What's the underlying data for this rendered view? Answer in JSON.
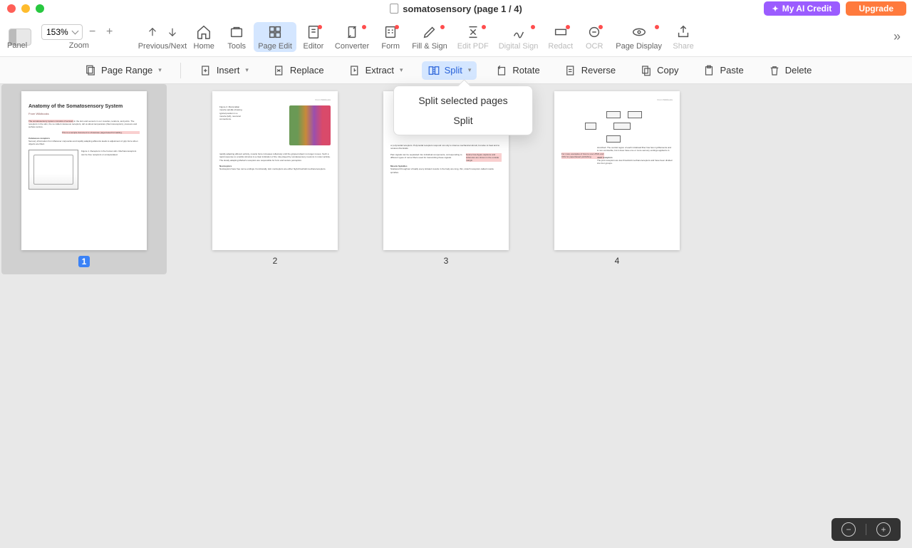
{
  "title": "somatosensory (page 1 / 4)",
  "header": {
    "ai_button": "My AI Credit",
    "upgrade_button": "Upgrade"
  },
  "toolbar": {
    "panel": "Panel",
    "zoom_label": "Zoom",
    "zoom_value": "153%",
    "prev_next": "Previous/Next",
    "home": "Home",
    "tools": "Tools",
    "page_edit": "Page Edit",
    "editor": "Editor",
    "converter": "Converter",
    "form": "Form",
    "fill_sign": "Fill & Sign",
    "edit_pdf": "Edit PDF",
    "digital_sign": "Digital Sign",
    "redact": "Redact",
    "ocr": "OCR",
    "page_display": "Page Display",
    "share": "Share"
  },
  "secondary": {
    "page_range": "Page Range",
    "insert": "Insert",
    "replace": "Replace",
    "extract": "Extract",
    "split": "Split",
    "rotate": "Rotate",
    "reverse": "Reverse",
    "copy": "Copy",
    "paste": "Paste",
    "delete": "Delete"
  },
  "dropdown": {
    "split_selected": "Split selected pages",
    "split": "Split"
  },
  "pages": {
    "p1": {
      "num": "1",
      "title": "Anatomy of the Somatosensory System",
      "sub": "From Wikibooks"
    },
    "p2": {
      "num": "2"
    },
    "p3": {
      "num": "3"
    },
    "p4": {
      "num": "4"
    }
  }
}
